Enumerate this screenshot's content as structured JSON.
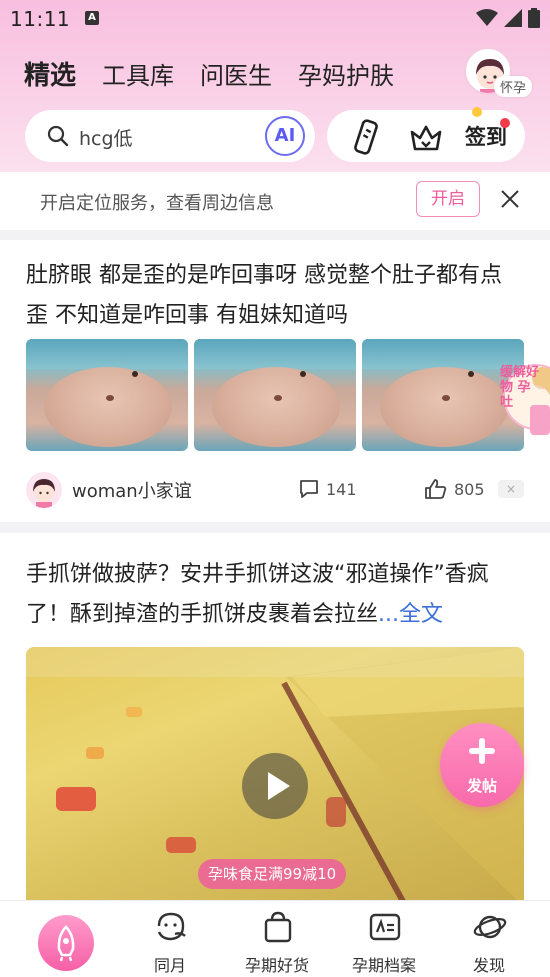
{
  "status_bar": {
    "time": "11:11",
    "notification_letter": "A"
  },
  "header": {
    "tabs": [
      {
        "label": "精选",
        "active": true
      },
      {
        "label": "工具库",
        "active": false
      },
      {
        "label": "问医生",
        "active": false
      },
      {
        "label": "孕妈护肤",
        "active": false
      }
    ],
    "stage_badge": "怀孕"
  },
  "search": {
    "query": "hcg低",
    "ai_label": "AI",
    "signin_label": "签到"
  },
  "location_bar": {
    "message": "开启定位服务，查看周边信息",
    "open_label": "开启"
  },
  "feed": [
    {
      "title": "肚脐眼 都是歪的是咋回事呀 感觉整个肚子都有点歪 不知道是咋回事 有姐妹知道吗",
      "image_count": 3,
      "author": "woman小家谊",
      "comments": "141",
      "likes": "805",
      "dismiss_label": "×"
    },
    {
      "title": "手抓饼做披萨？安井手抓饼这波“邪道操作”香疯了！酥到掉渣的手抓饼皮裹着会拉丝",
      "more_label": "...全文",
      "video_tag": "孕味食足满99减10"
    }
  ],
  "floating_ad": {
    "text": "缓解好物 孕吐"
  },
  "fab": {
    "label": "发帖"
  },
  "bottom_nav": [
    {
      "label": "",
      "icon": "home-rocket-icon"
    },
    {
      "label": "同月",
      "icon": "same-month-icon"
    },
    {
      "label": "孕期好货",
      "icon": "shopping-bag-icon"
    },
    {
      "label": "孕期档案",
      "icon": "profile-card-icon"
    },
    {
      "label": "发现",
      "icon": "planet-icon"
    }
  ],
  "colors": {
    "accent_pink": "#ef5e9c",
    "ai_blue": "#5b5bef",
    "link_blue": "#3d6fd8"
  }
}
